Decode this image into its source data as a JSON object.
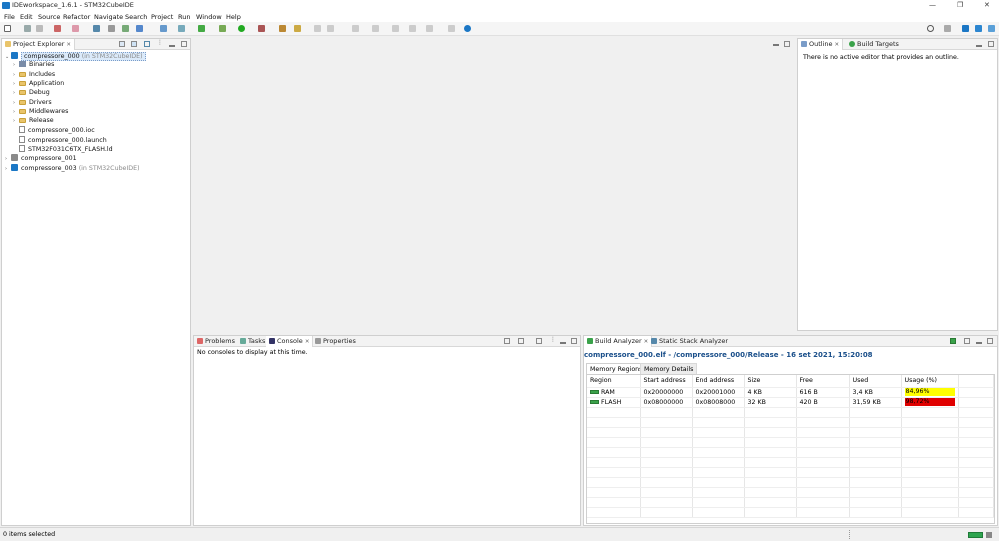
{
  "window": {
    "title": "IDEworkspace_1.6.1 - STM32CubeIDE",
    "minimize": "—",
    "maximize": "❐",
    "close": "✕"
  },
  "menu": [
    "File",
    "Edit",
    "Source",
    "Refactor",
    "Navigate",
    "Search",
    "Project",
    "Run",
    "Window",
    "Help"
  ],
  "project_explorer": {
    "tab": "Project Explorer",
    "tree": [
      {
        "label": "compressore_000",
        "suffix": " (in STM32CubeIDE)",
        "level": 0,
        "chevron": "⌄",
        "icon": "project-icon",
        "selected": true
      },
      {
        "label": "Binaries",
        "level": 1,
        "chevron": "›",
        "icon": "binaries-icon"
      },
      {
        "label": "Includes",
        "level": 1,
        "chevron": "›",
        "icon": "includes-icon"
      },
      {
        "label": "Application",
        "level": 1,
        "chevron": "›",
        "icon": "folder-icon"
      },
      {
        "label": "Debug",
        "level": 1,
        "chevron": "›",
        "icon": "folder-icon"
      },
      {
        "label": "Drivers",
        "level": 1,
        "chevron": "›",
        "icon": "folder-icon"
      },
      {
        "label": "Middlewares",
        "level": 1,
        "chevron": "›",
        "icon": "folder-icon"
      },
      {
        "label": "Release",
        "level": 1,
        "chevron": "›",
        "icon": "folder-icon"
      },
      {
        "label": "compressore_000.ioc",
        "level": 1,
        "chevron": "",
        "icon": "ioc-file-icon"
      },
      {
        "label": "compressore_000.launch",
        "level": 1,
        "chevron": "",
        "icon": "launch-file-icon"
      },
      {
        "label": "STM32F031C6TX_FLASH.ld",
        "level": 1,
        "chevron": "",
        "icon": "ld-file-icon"
      },
      {
        "label": "compressore_001",
        "level": 0,
        "chevron": "›",
        "icon": "closed-project-icon"
      },
      {
        "label": "compressore_003",
        "suffix": " (in STM32CubeIDE)",
        "level": 0,
        "chevron": "›",
        "icon": "project-icon"
      }
    ]
  },
  "outline": {
    "tabs": [
      "Outline",
      "Build Targets"
    ],
    "message": "There is no active editor that provides an outline."
  },
  "console": {
    "tabs": [
      "Problems",
      "Tasks",
      "Console",
      "Properties"
    ],
    "message": "No consoles to display at this time."
  },
  "build_analyzer": {
    "tabs": [
      "Build Analyzer",
      "Static Stack Analyzer"
    ],
    "heading": "compressore_000.elf - /compressore_000/Release - 16 set 2021, 15:20:08",
    "subtabs": [
      "Memory Regions",
      "Memory Details"
    ],
    "columns": [
      "Region",
      "Start address",
      "End address",
      "Size",
      "Free",
      "Used",
      "Usage (%)"
    ],
    "rows": [
      {
        "region": "RAM",
        "start": "0x20000000",
        "end": "0x20001000",
        "size": "4 KB",
        "free": "616 B",
        "used": "3,4 KB",
        "usage": "84,96%",
        "color": "#ffff00"
      },
      {
        "region": "FLASH",
        "start": "0x08000000",
        "end": "0x08008000",
        "size": "32 KB",
        "free": "420 B",
        "used": "31,59 KB",
        "usage": "98,72%",
        "color": "#e00000"
      }
    ]
  },
  "status": {
    "text": "0 items selected"
  },
  "colors": {
    "accent": "#1b77c5",
    "heading": "#1a4f8a"
  }
}
